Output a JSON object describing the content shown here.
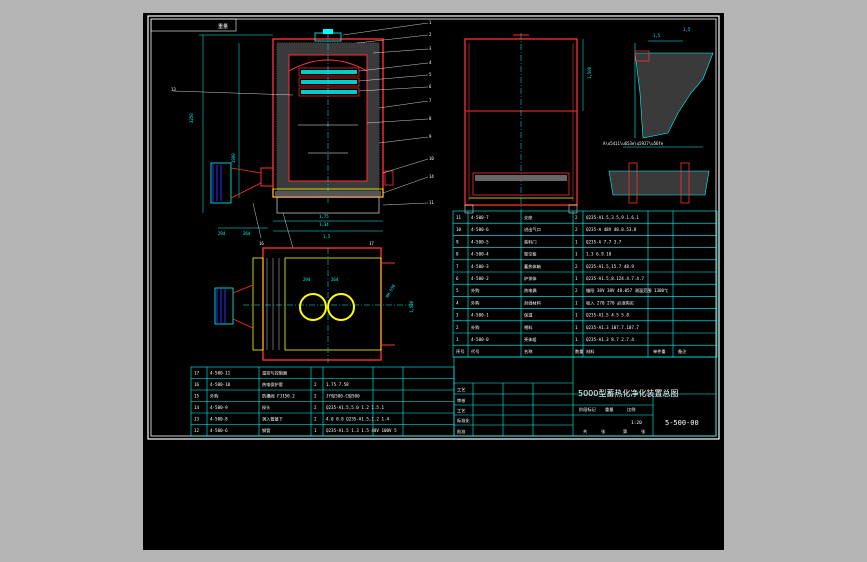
{
  "drawing": {
    "title": "5000型蓄热化净化装置总图",
    "number": "5-500-00",
    "scale": "1:20",
    "corner_tag": "重量",
    "dims": {
      "a": "1,1",
      "b": "1,34",
      "c": "1,3",
      "d": "1,500",
      "e": "1,1"
    },
    "title_block_rows": [
      "工艺",
      "审核",
      "工艺",
      "标准化",
      "批准"
    ],
    "title_block_labels": [
      "阶段标记",
      "重量",
      "比例",
      "共",
      "张",
      "第",
      "张"
    ]
  },
  "bom_right": {
    "headers": [
      "序号",
      "代号",
      "名称",
      "数量",
      "材料",
      "单件重",
      "备注"
    ],
    "rows": [
      [
        "11",
        "4-500-7",
        "支座",
        "2",
        "Q235-A1.5,3.5,9.1.6.1"
      ],
      [
        "10",
        "4-500-6",
        "进出气口",
        "2",
        "Q235-A 48V 48.0.53.8"
      ],
      [
        "9",
        "4-500-5",
        "装料门",
        "1",
        "Q235-A 7.7 3.7"
      ],
      [
        "8",
        "4-500-4",
        "架空板",
        "1",
        "1.3 6.9.10"
      ],
      [
        "7",
        "4-500-3",
        "蓄热体箱",
        "2",
        "Q235-A1.5,15.7 48.9"
      ],
      [
        "6",
        "4-500-2",
        "炉排体",
        "1",
        "Q235-A1.5,8.124.4.7.4.7"
      ],
      [
        "5",
        "外购",
        "热电偶",
        "2",
        "镚阳 38V 38V 48.057 测温范围 1300℃"
      ],
      [
        "4",
        "外购",
        "封线材料",
        "1",
        "吸入  270  270 必须购买"
      ],
      [
        "3",
        "4-500-1",
        "保温",
        "1",
        "Q235-A1.5  4.5 5.8"
      ],
      [
        "2",
        "外购",
        "喂料",
        "1",
        "Q235-A1.3  107.7.107.7"
      ],
      [
        "1",
        "4-500-0",
        "壳体组",
        "1",
        "Q235-A1.3  8.7 2.7.4"
      ]
    ]
  },
  "bom_left": {
    "rows": [
      [
        "17",
        "4-500-11",
        "温控与控制器",
        "",
        ""
      ],
      [
        "16",
        "4-500-10",
        "热电保护套",
        "2",
        "1.75 7.58"
      ],
      [
        "15",
        "外购",
        "防爆阀 FJ150.2",
        "2",
        "JY型500-C型500"
      ],
      [
        "14",
        "4-500-9",
        "探头",
        "2",
        "Q235-A1.5,5.0  1.2 1.5.1"
      ],
      [
        "13",
        "4-500-8",
        "涡入管基下",
        "2",
        "4.0  0.8  Q235-A1.5,1.2 1.4"
      ],
      [
        "12",
        "4-500-6",
        "钢管",
        "1",
        "Q235-A1.5  1.3  1.5  48V 100V 5"
      ]
    ]
  },
  "callouts": [
    "1",
    "2",
    "3",
    "4",
    "5",
    "6",
    "7",
    "8",
    "9",
    "10",
    "11",
    "12",
    "13",
    "14",
    "15",
    "16",
    "17"
  ]
}
